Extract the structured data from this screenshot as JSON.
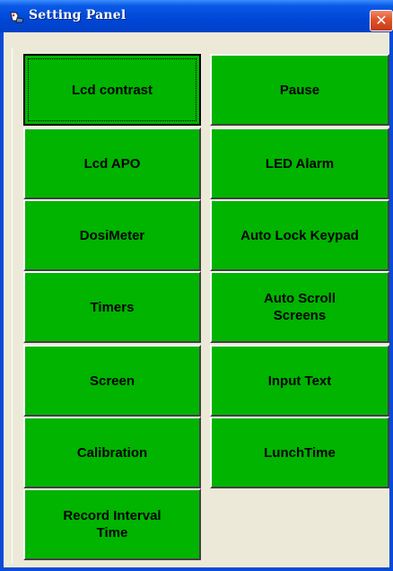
{
  "window": {
    "title": "Setting Panel",
    "close_label": "✕"
  },
  "left_buttons": [
    {
      "label": "Lcd contrast"
    },
    {
      "label": "Lcd APO"
    },
    {
      "label": "DosiMeter"
    },
    {
      "label": "Timers"
    },
    {
      "label": "Screen"
    },
    {
      "label": "Calibration"
    },
    {
      "label": "Record Interval\nTime"
    }
  ],
  "right_buttons": [
    {
      "label": "Pause"
    },
    {
      "label": "LED Alarm"
    },
    {
      "label": "Auto Lock Keypad"
    },
    {
      "label": "Auto Scroll\nScreens"
    },
    {
      "label": "Input Text"
    },
    {
      "label": "LunchTime"
    }
  ],
  "colors": {
    "button_green": "#00b400",
    "title_blue": "#0046d6",
    "close_red": "#e0532a",
    "panel_bg": "#ece9d8"
  }
}
